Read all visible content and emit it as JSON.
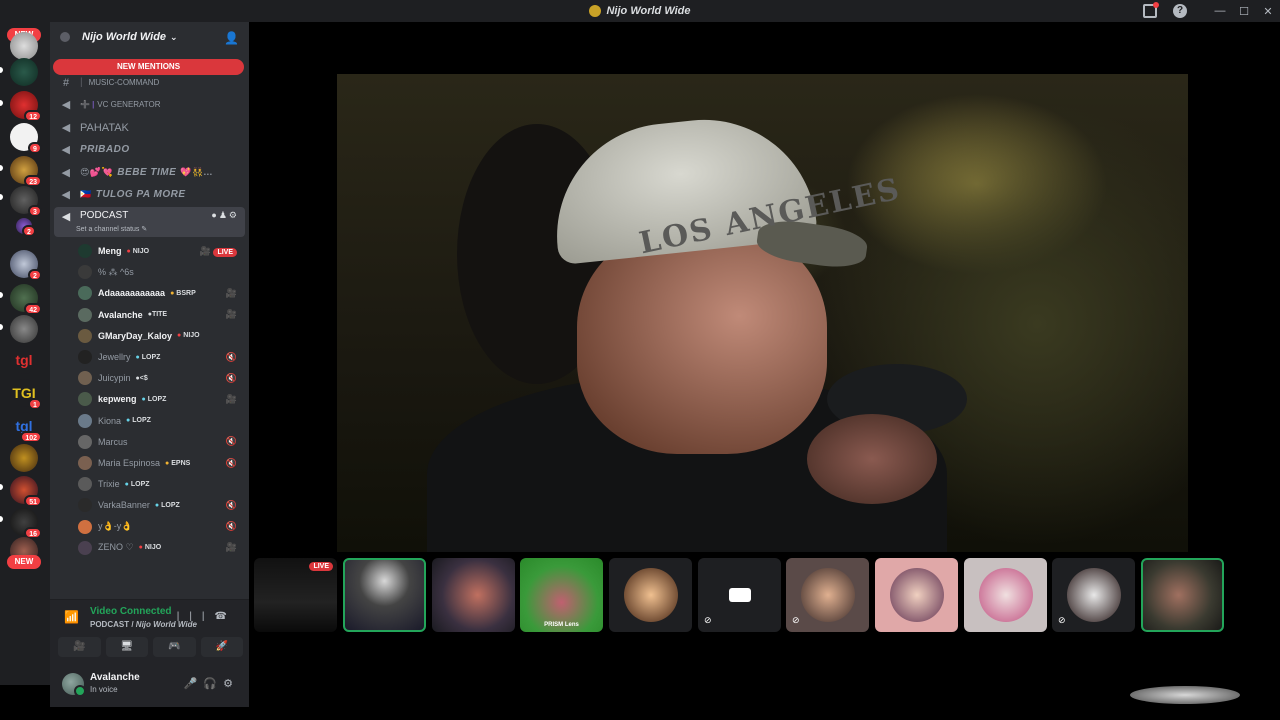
{
  "window": {
    "title": "Nijo World Wide",
    "controls": [
      "—",
      "☐",
      "✕"
    ],
    "help": "?"
  },
  "rail": {
    "new_top": "NEW",
    "new_bottom": "NEW",
    "badges": [
      "12",
      "9",
      "23",
      "3",
      "2",
      "2",
      "42",
      "1",
      "102",
      "51",
      "16"
    ]
  },
  "guild": {
    "name": "Nijo World Wide",
    "new_mentions": "NEW MENTIONS"
  },
  "channels": [
    {
      "icon": "#",
      "name": "MUSIC-COMMAND",
      "prefix": "",
      "style": "normal"
    },
    {
      "icon": "🔊",
      "name": "VC GENERATOR",
      "prefix": "➕ |",
      "style": "normal"
    },
    {
      "icon": "🔊",
      "name": "PAHATAK",
      "prefix": "",
      "style": "plain-large"
    },
    {
      "icon": "🔊",
      "name": "PRIBADO",
      "prefix": "",
      "style": "bold-it"
    },
    {
      "icon": "🔊",
      "name": "BEBE TIME",
      "prefix": "😍💕💘",
      "suffix": "💖👯...",
      "style": "bold-it"
    },
    {
      "icon": "🔊",
      "name": "TULOG PA MORE",
      "prefix": "🇵🇭",
      "style": "bold-it"
    }
  ],
  "active_channel": {
    "name": "PODCAST",
    "status": "Set a channel status ✎"
  },
  "members": [
    {
      "name": "Meng",
      "tag": "NIJO",
      "tag_color": "red",
      "right": "🎥 LIVE",
      "live": true,
      "bold": true
    },
    {
      "name": "% ⁂ ^6s",
      "tag": "",
      "tag_color": "",
      "right": "",
      "live": false,
      "bold": false
    },
    {
      "name": "Adaaaaaaaaaaa",
      "tag": "BSRP",
      "tag_color": "yellow",
      "right": "🎥",
      "live": false,
      "bold": true
    },
    {
      "name": "Avalanche",
      "tag": "TITE",
      "tag_color": "grey",
      "right": "🎥",
      "live": false,
      "bold": true
    },
    {
      "name": "GMaryDay_Kaloy",
      "tag": "NIJO",
      "tag_color": "red",
      "right": "",
      "live": false,
      "bold": true
    },
    {
      "name": "Jewellry",
      "tag": "LOPZ",
      "tag_color": "cyan",
      "right": "🔇",
      "live": false,
      "bold": false
    },
    {
      "name": "Juicypin",
      "tag": "<$",
      "tag_color": "grey",
      "right": "🔇",
      "live": false,
      "bold": false
    },
    {
      "name": "kepweng",
      "tag": "LOPZ",
      "tag_color": "cyan",
      "right": "🎥",
      "live": false,
      "bold": true
    },
    {
      "name": "Kiona",
      "tag": "LOPZ",
      "tag_color": "cyan",
      "right": "",
      "live": false,
      "bold": false
    },
    {
      "name": "Marcus",
      "tag": "",
      "tag_color": "",
      "right": "🔇",
      "live": false,
      "bold": false
    },
    {
      "name": "Maria Espinosa",
      "tag": "EPNS",
      "tag_color": "yellow",
      "right": "🔇",
      "live": false,
      "bold": false
    },
    {
      "name": "Trixie",
      "tag": "LOPZ",
      "tag_color": "cyan",
      "right": "",
      "live": false,
      "bold": false
    },
    {
      "name": "VarkaBanner",
      "tag": "LOPZ",
      "tag_color": "cyan",
      "right": "🔇",
      "live": false,
      "bold": false
    },
    {
      "name": "y👌-y👌",
      "tag": "",
      "tag_color": "",
      "right": "🔇",
      "live": false,
      "bold": false
    },
    {
      "name": "ZENO ♡",
      "tag": "NIJO",
      "tag_color": "red",
      "right": "🎥",
      "live": false,
      "bold": false
    }
  ],
  "voice": {
    "title": "Video Connected",
    "channel": "PODCAST",
    "server": "Nijo World Wide",
    "buttons": [
      "🎥",
      "🖥",
      "🎮",
      "🚀"
    ]
  },
  "me": {
    "name": "Avalanche",
    "status": "In voice"
  },
  "video": {
    "cap_text": "LOS ANGELES"
  },
  "thumbnails": [
    {
      "kind": "stream",
      "live": "LIVE"
    },
    {
      "kind": "camera",
      "speaking": true
    },
    {
      "kind": "camera",
      "speaking": false
    },
    {
      "kind": "prism",
      "label": "PRISM Lens"
    },
    {
      "kind": "avatar",
      "speaking": false
    },
    {
      "kind": "cam-off",
      "speaking": false
    },
    {
      "kind": "avatar",
      "speaking": false
    },
    {
      "kind": "avatar",
      "speaking": false
    },
    {
      "kind": "avatar",
      "speaking": false
    },
    {
      "kind": "avatar",
      "speaking": false
    },
    {
      "kind": "camera",
      "speaking": true
    }
  ],
  "colors": {
    "accent_green": "#23a55a",
    "danger_red": "#da373c",
    "bg_dark": "#1e1f22",
    "sidebar": "#2b2d31"
  }
}
